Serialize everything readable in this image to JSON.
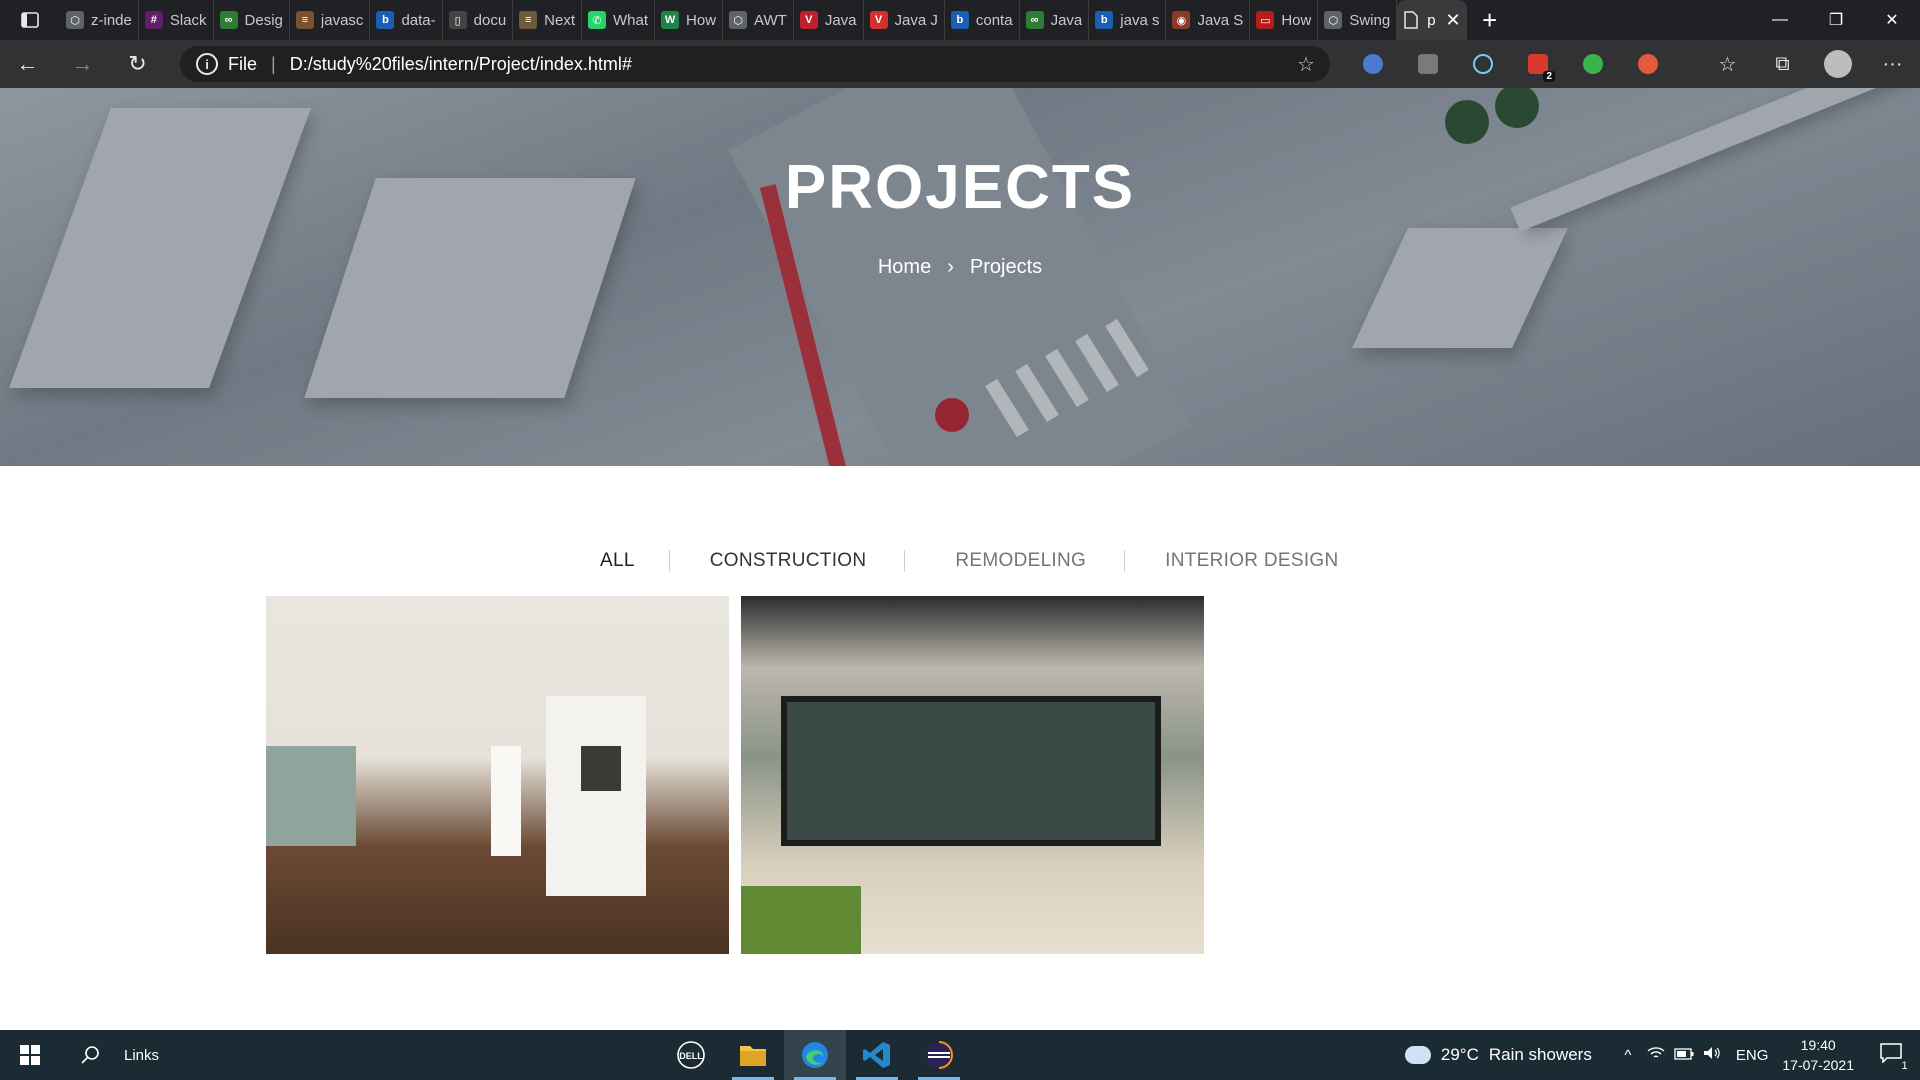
{
  "browser": {
    "tabs": [
      {
        "title": "z-inde",
        "fav_color": "#5f6368",
        "fav_glyph": "⬡"
      },
      {
        "title": "Slack",
        "fav_color": "#611f69",
        "fav_glyph": "#"
      },
      {
        "title": "Desig",
        "fav_color": "#2e7d32",
        "fav_glyph": "∞"
      },
      {
        "title": "javasc",
        "fav_color": "#7a5230",
        "fav_glyph": "≡"
      },
      {
        "title": "data-",
        "fav_color": "#1a5fb4",
        "fav_glyph": "b"
      },
      {
        "title": "docu",
        "fav_color": "#444444",
        "fav_glyph": "▯"
      },
      {
        "title": "Next",
        "fav_color": "#6d5a3a",
        "fav_glyph": "≡"
      },
      {
        "title": "What",
        "fav_color": "#25d366",
        "fav_glyph": "✆"
      },
      {
        "title": "How",
        "fav_color": "#1e8449",
        "fav_glyph": "W"
      },
      {
        "title": "AWT",
        "fav_color": "#5f6368",
        "fav_glyph": "⬡"
      },
      {
        "title": "Java",
        "fav_color": "#c0202b",
        "fav_glyph": "V"
      },
      {
        "title": "Java J",
        "fav_color": "#d32f2f",
        "fav_glyph": "V"
      },
      {
        "title": "conta",
        "fav_color": "#1a5fb4",
        "fav_glyph": "b"
      },
      {
        "title": "Java",
        "fav_color": "#2e7d32",
        "fav_glyph": "∞"
      },
      {
        "title": "java s",
        "fav_color": "#1a5fb4",
        "fav_glyph": "b"
      },
      {
        "title": "Java S",
        "fav_color": "#8a3b2a",
        "fav_glyph": "◉"
      },
      {
        "title": "How",
        "fav_color": "#b71c1c",
        "fav_glyph": "▭"
      },
      {
        "title": "Swing",
        "fav_color": "#5f6368",
        "fav_glyph": "⬡"
      }
    ],
    "active_tab": {
      "title": "p",
      "close": "✕"
    },
    "new_tab": "+",
    "window_controls": {
      "minimize": "—",
      "maximize": "❐",
      "close": "✕"
    },
    "nav": {
      "back": "←",
      "forward": "→",
      "reload": "↻"
    },
    "address": {
      "info": "i",
      "scheme": "File",
      "separator": "|",
      "url": "D:/study%20files/intern/Project/index.html#",
      "favorite": "☆"
    },
    "extensions": [
      {
        "name": "extension-1-icon",
        "color": "#4a7bd0"
      },
      {
        "name": "extension-2-icon",
        "color": "#7a7a7a"
      },
      {
        "name": "react-devtools-icon",
        "color": "#6fd0f0"
      },
      {
        "name": "extension-todo-icon",
        "color": "#d93a2e"
      },
      {
        "name": "extension-green-icon",
        "color": "#37b24d"
      },
      {
        "name": "extension-timer-icon",
        "color": "#e45a3a"
      }
    ],
    "extension_badge": "2",
    "tools": {
      "favorites": "☆",
      "collections": "⧉",
      "more": "···"
    }
  },
  "hero": {
    "title": "PROJECTS",
    "breadcrumb_home": "Home",
    "breadcrumb_sep": "›",
    "breadcrumb_current": "Projects"
  },
  "filters": [
    "ALL",
    "CONSTRUCTION",
    "REMODELING",
    "INTERIOR DESIGN"
  ],
  "taskbar": {
    "links": "Links",
    "weather_temp": "29°C",
    "weather_desc": "Rain showers",
    "chevron": "^",
    "lang": "ENG",
    "time": "19:40",
    "date": "17-07-2021",
    "notifications": "1",
    "apps": [
      "dell-icon",
      "file-explorer-icon",
      "edge-icon",
      "vscode-icon",
      "eclipse-icon"
    ]
  }
}
